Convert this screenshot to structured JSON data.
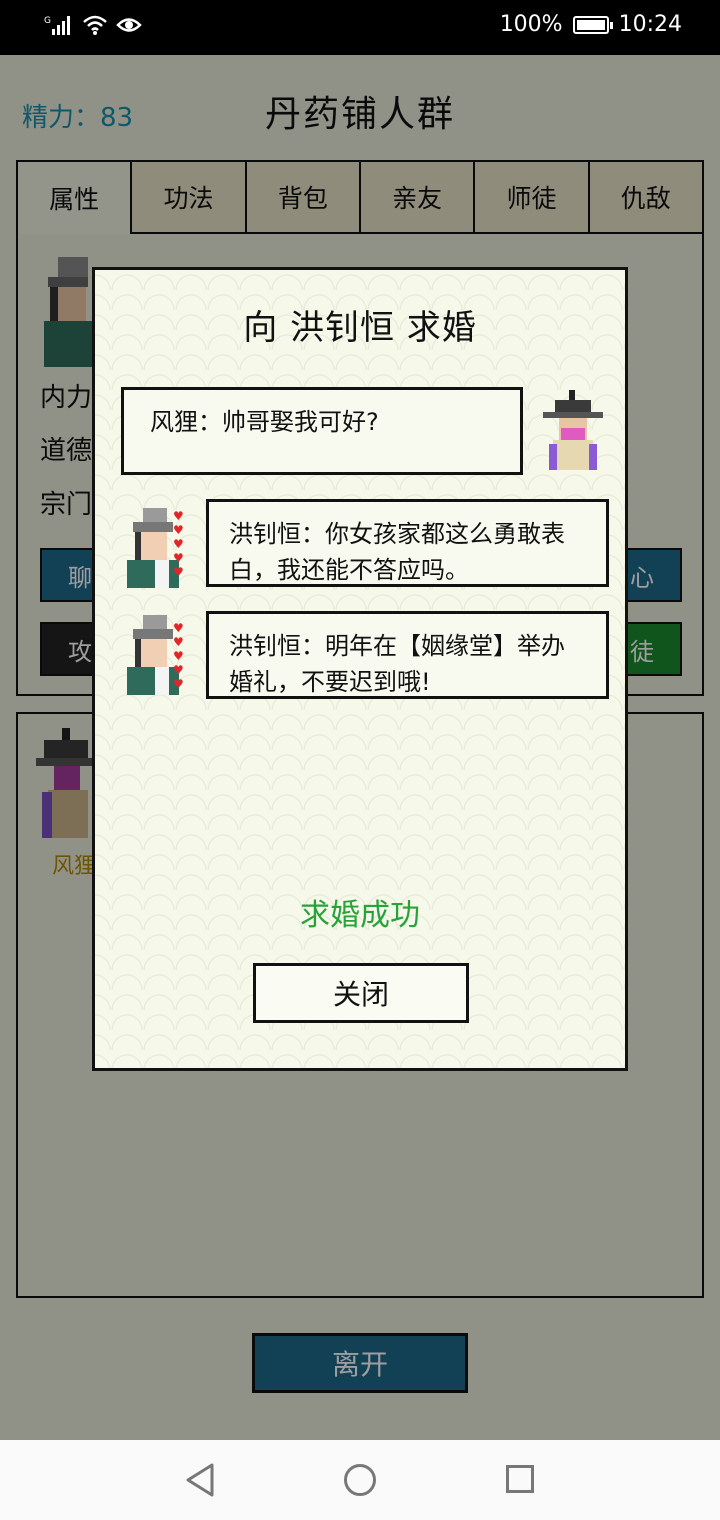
{
  "status_bar": {
    "network": "G",
    "battery_percent": "100%",
    "time": "10:24",
    "icons": [
      "signal-icon",
      "wifi-icon",
      "eye-icon",
      "battery-icon"
    ]
  },
  "game": {
    "energy_label": "精力：83",
    "title": "丹药铺人群",
    "tabs": [
      "属性",
      "功法",
      "背包",
      "亲友",
      "师徒",
      "仇敌"
    ],
    "active_tab": "属性",
    "fields": [
      "内力",
      "道德",
      "宗门"
    ],
    "left_buttons": [
      "聊",
      "攻"
    ],
    "right_buttons": [
      "心",
      "徒"
    ],
    "crowd_member_name": "风狸",
    "leave_button": "离开",
    "colors": {
      "teal_button": "#1d6a8a",
      "green_button": "#1a8a2e",
      "dark_button": "#222222",
      "energy": "#1a8fa8"
    }
  },
  "modal": {
    "title": "向 洪钊恒 求婚",
    "messages": [
      {
        "speaker": "风狸",
        "text": "风狸：帅哥娶我可好?"
      },
      {
        "speaker": "洪钊恒",
        "text": "洪钊恒：你女孩家都这么勇敢表白，我还能不答应吗。"
      },
      {
        "speaker": "洪钊恒",
        "text": "洪钊恒：明年在【姻缘堂】举办婚礼，不要迟到哦!"
      }
    ],
    "result_text": "求婚成功",
    "close_button": "关闭",
    "colors": {
      "result": "#27a33a",
      "hearts": "#e0262a"
    }
  },
  "navbar": {
    "buttons": [
      "back-icon",
      "home-icon",
      "recent-apps-icon"
    ]
  }
}
